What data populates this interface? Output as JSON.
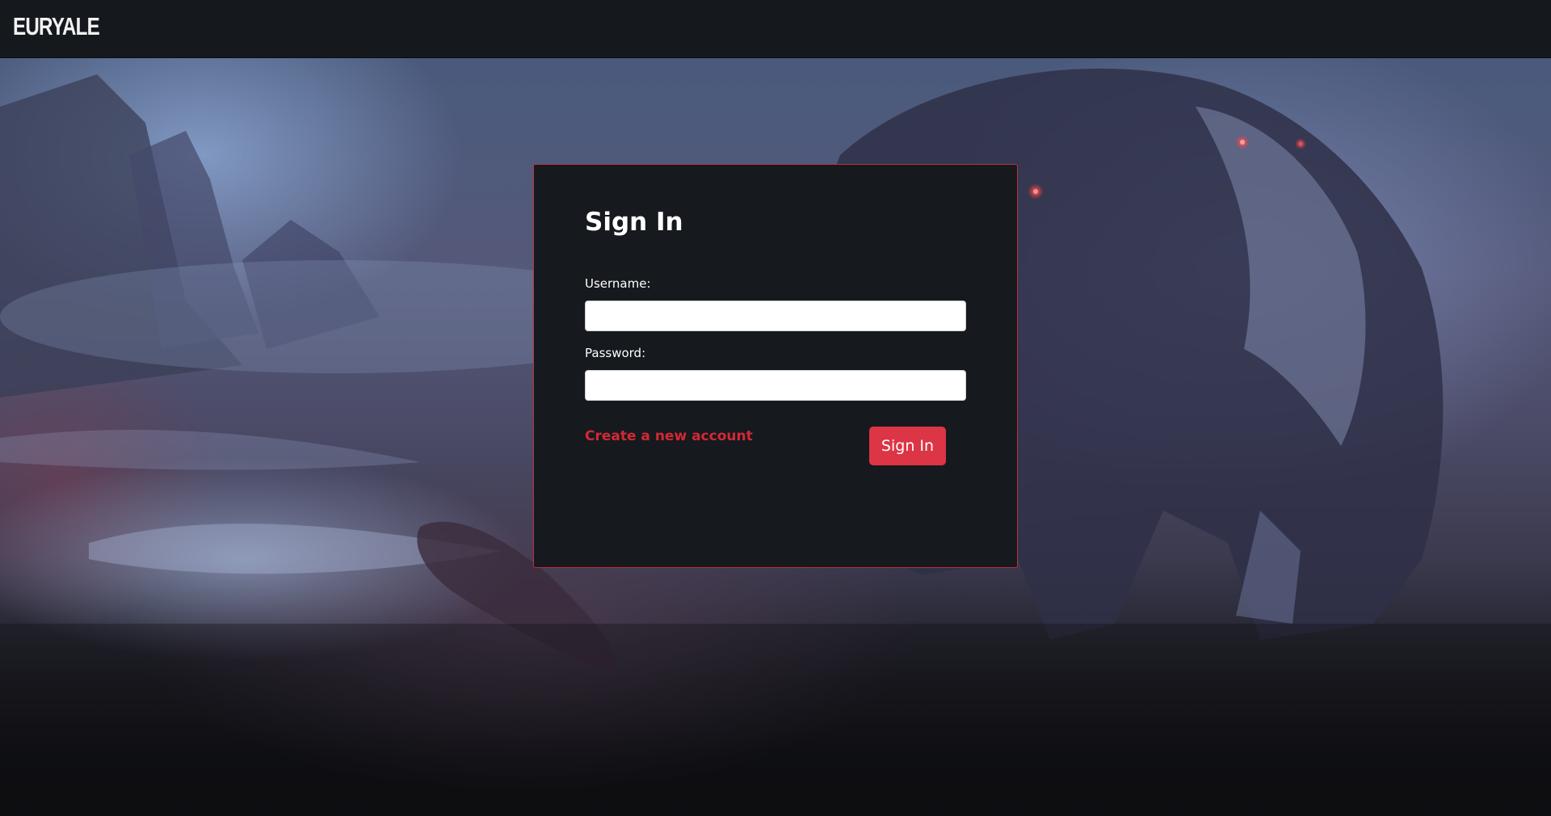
{
  "navbar": {
    "brand": "EURYALE"
  },
  "signin_form": {
    "title": "Sign In",
    "username": {
      "label": "Username:",
      "value": "",
      "placeholder": ""
    },
    "password": {
      "label": "Password:",
      "value": "",
      "placeholder": ""
    },
    "create_account_link": "Create a new account",
    "submit_label": "Sign In"
  },
  "colors": {
    "navbar_bg": "#15191d",
    "card_bg": "#16191d",
    "card_border": "#b8323f",
    "accent": "#dc3545",
    "link": "#d32836"
  }
}
